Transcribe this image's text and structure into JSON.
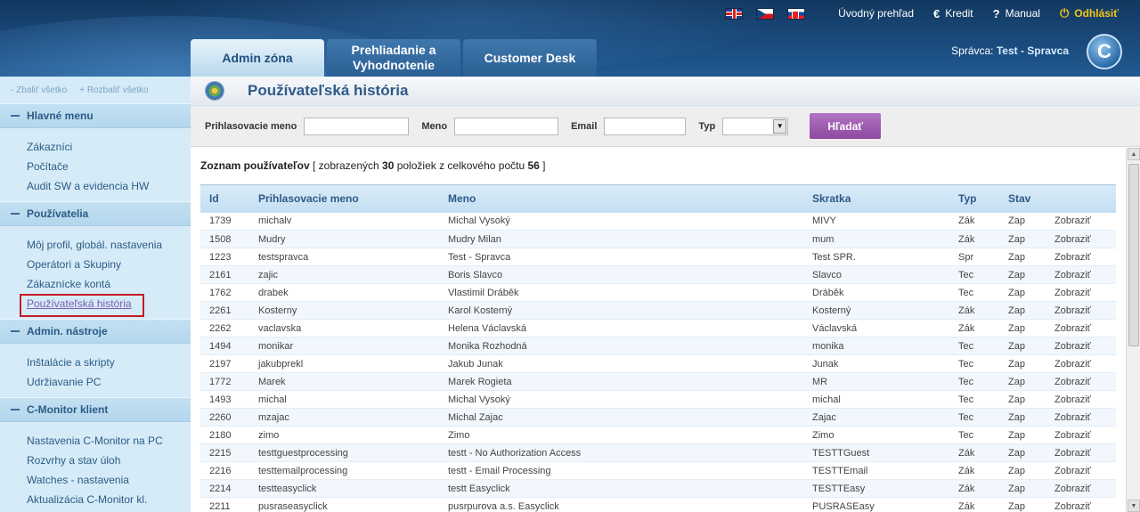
{
  "topnav": {
    "flags": [
      "flag-uk-icon",
      "flag-cz-icon",
      "flag-sk-icon"
    ],
    "overview": "Úvodný prehľad",
    "credit": "Kredit",
    "manual": "Manual",
    "logout": "Odhlásiť",
    "credit_icon": "€",
    "manual_icon": "?",
    "logout_icon": "⏻"
  },
  "tabs": [
    {
      "label": "Admin zóna"
    },
    {
      "label": "Prehliadanie a Vyhodnotenie"
    },
    {
      "label": "Customer Desk"
    }
  ],
  "admin": {
    "prefix": "Správca:",
    "name": "Test - Spravca"
  },
  "logo": {
    "letter": "C"
  },
  "sidebar": {
    "collapse_all": "- Zbaliť všetko",
    "expand_all": "+ Rozbaliť všetko",
    "sections": [
      {
        "title": "Hlavné menu",
        "items": [
          "Zákazníci",
          "Počítače",
          "Audit SW a evidencia HW"
        ]
      },
      {
        "title": "Používatelia",
        "items": [
          "Môj profil, globál. nastavenia",
          "Operátori a Skupiny",
          "Zákaznícke kontá",
          "Používateľská história"
        ]
      },
      {
        "title": "Admin. nástroje",
        "items": [
          "Inštalácie a skripty",
          "Udržiavanie PC"
        ]
      },
      {
        "title": "C-Monitor klient",
        "items": [
          "Nastavenia C-Monitor na PC",
          "Rozvrhy a stav úloh",
          "Watches - nastavenia",
          "Aktualizácia C-Monitor kl."
        ]
      }
    ]
  },
  "page": {
    "title": "Používateľská história"
  },
  "filter": {
    "login_label": "Prihlasovacie meno",
    "login_value": "",
    "name_label": "Meno",
    "name_value": "",
    "email_label": "Email",
    "email_value": "",
    "type_label": "Typ",
    "type_value": "",
    "search_button": "Hľadať"
  },
  "list": {
    "title": "Zoznam používateľov",
    "info_pre": " [ zobrazených ",
    "shown": "30",
    "info_mid": " položiek z celkového počtu ",
    "total": "56",
    "info_post": " ]"
  },
  "table": {
    "headers": [
      "Id",
      "Prihlasovacie meno",
      "Meno",
      "Skratka",
      "Typ",
      "Stav",
      ""
    ],
    "rows": [
      [
        "1739",
        "michalv",
        "Michal Vysoký",
        "MIVY",
        "Zák",
        "Zap",
        "Zobraziť"
      ],
      [
        "1508",
        "Mudry",
        "Mudry Milan",
        "mum",
        "Zák",
        "Zap",
        "Zobraziť"
      ],
      [
        "1223",
        "testspravca",
        "Test - Spravca",
        "Test SPR.",
        "Spr",
        "Zap",
        "Zobraziť"
      ],
      [
        "2161",
        "zajic",
        "Boris Slavco",
        "Slavco",
        "Tec",
        "Zap",
        "Zobraziť"
      ],
      [
        "1762",
        "drabek",
        "Vlastimil Dráběk",
        "Dráběk",
        "Tec",
        "Zap",
        "Zobraziť"
      ],
      [
        "2261",
        "Kosterny",
        "Karol Kosterný",
        "Kosterný",
        "Zák",
        "Zap",
        "Zobraziť"
      ],
      [
        "2262",
        "vaclavska",
        "Helena Václavská",
        "Václavská",
        "Zák",
        "Zap",
        "Zobraziť"
      ],
      [
        "1494",
        "monikar",
        "Monika Rozhodná",
        "monika",
        "Tec",
        "Zap",
        "Zobraziť"
      ],
      [
        "2197",
        "jakubprekl",
        "Jakub Junak",
        "Junak",
        "Tec",
        "Zap",
        "Zobraziť"
      ],
      [
        "1772",
        "Marek",
        "Marek Rogieta",
        "MR",
        "Tec",
        "Zap",
        "Zobraziť"
      ],
      [
        "1493",
        "michal",
        "Michal Vysoký",
        "michal",
        "Tec",
        "Zap",
        "Zobraziť"
      ],
      [
        "2260",
        "mzajac",
        "Michal Zajac",
        "Zajac",
        "Tec",
        "Zap",
        "Zobraziť"
      ],
      [
        "2180",
        "zimo",
        "Zimo",
        "Zimo",
        "Tec",
        "Zap",
        "Zobraziť"
      ],
      [
        "2215",
        "testtguestprocessing",
        "testt - No Authorization Access",
        "TESTTGuest",
        "Zák",
        "Zap",
        "Zobraziť"
      ],
      [
        "2216",
        "testtemailprocessing",
        "testt - Email Processing",
        "TESTTEmail",
        "Zák",
        "Zap",
        "Zobraziť"
      ],
      [
        "2214",
        "testteasyclick",
        "testt Easyclick",
        "TESTTEasy",
        "Zák",
        "Zap",
        "Zobraziť"
      ],
      [
        "2211",
        "pusraseasyclick",
        "pusrpurova a.s. Easyclick",
        "PUSRASEasy",
        "Zák",
        "Zap",
        "Zobraziť"
      ]
    ]
  },
  "colors": {
    "accent": "#2e5a88",
    "search_button": "#a05db3",
    "active_item_border": "#c41c24"
  }
}
